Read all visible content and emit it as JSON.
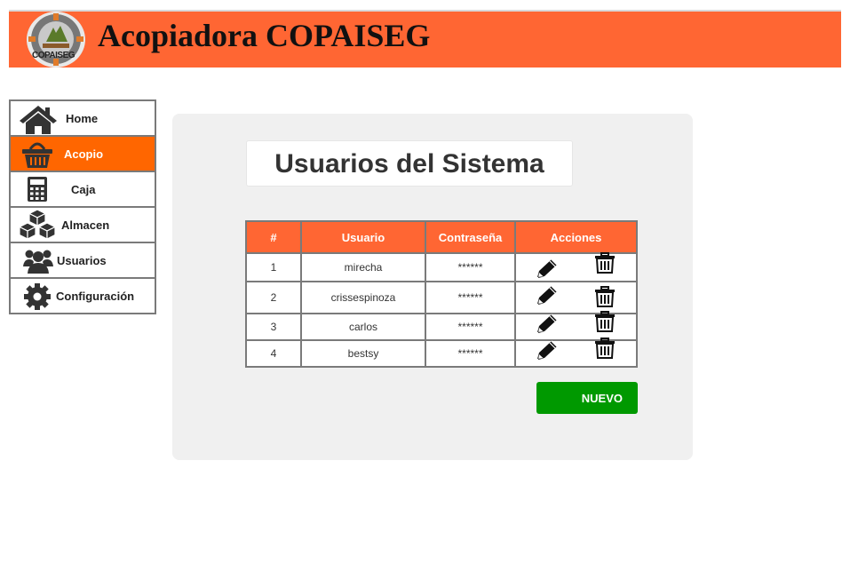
{
  "header": {
    "title": "Acopiadora COPAISEG",
    "logo_text": "COPAISEG"
  },
  "sidebar": {
    "items": [
      {
        "label": "Home",
        "icon": "home-icon",
        "active": false
      },
      {
        "label": "Acopio",
        "icon": "basket-icon",
        "active": true
      },
      {
        "label": "Caja",
        "icon": "calculator-icon",
        "active": false
      },
      {
        "label": "Almacen",
        "icon": "boxes-icon",
        "active": false
      },
      {
        "label": "Usuarios",
        "icon": "users-icon",
        "active": false
      },
      {
        "label": "Configuración",
        "icon": "gear-icon",
        "active": false
      }
    ]
  },
  "main": {
    "title": "Usuarios del Sistema",
    "table": {
      "headers": [
        "#",
        "Usuario",
        "Contraseña",
        "Acciones"
      ],
      "rows": [
        {
          "num": "1",
          "usuario": "mirecha",
          "password": "******"
        },
        {
          "num": "2",
          "usuario": "crissespinoza",
          "password": "******"
        },
        {
          "num": "3",
          "usuario": "carlos",
          "password": "******"
        },
        {
          "num": "4",
          "usuario": "bestsy",
          "password": "******"
        }
      ],
      "action_icons": [
        "pencil-icon",
        "trash-icon"
      ]
    },
    "new_button": "NUEVO"
  },
  "colors": {
    "header_bg": "#ff6633",
    "active_nav": "#ff6600",
    "button_green": "#009900",
    "panel_bg": "#f0f0f0"
  }
}
